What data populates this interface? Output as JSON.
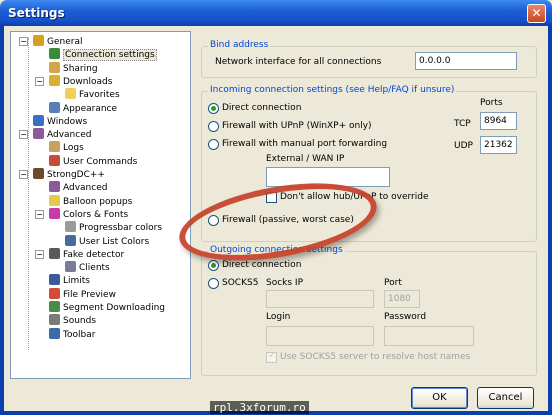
{
  "window": {
    "title": "Settings",
    "close_glyph": "✕"
  },
  "tree": {
    "items": [
      {
        "label": "General",
        "icon": "general-icon",
        "color": "#d8a020",
        "expander": "−"
      },
      {
        "label": "Connection settings",
        "icon": "connection-icon",
        "color": "#3a8a3a",
        "selected": true
      },
      {
        "label": "Sharing",
        "icon": "sharing-icon",
        "color": "#d4a64a"
      },
      {
        "label": "Downloads",
        "icon": "downloads-icon",
        "color": "#d8b030",
        "expander": "−"
      },
      {
        "label": "Favorites",
        "icon": "folder-icon",
        "color": "#f2cf5a"
      },
      {
        "label": "Appearance",
        "icon": "appearance-icon",
        "color": "#5a7fb8"
      },
      {
        "label": "Windows",
        "icon": "windows-icon",
        "color": "#3a6fc8"
      },
      {
        "label": "Advanced",
        "icon": "advanced-icon",
        "color": "#8a5a9a",
        "expander": "−"
      },
      {
        "label": "Logs",
        "icon": "logs-icon",
        "color": "#c8a060"
      },
      {
        "label": "User Commands",
        "icon": "user-commands-icon",
        "color": "#c84a3a"
      },
      {
        "label": "StrongDC++",
        "icon": "strongdc-icon",
        "color": "#6a4a2a",
        "expander": "−"
      },
      {
        "label": "Advanced",
        "icon": "advanced-icon",
        "color": "#8a5a9a"
      },
      {
        "label": "Balloon popups",
        "icon": "balloon-icon",
        "color": "#e8c84a"
      },
      {
        "label": "Colors & Fonts",
        "icon": "colors-icon",
        "color": "#c83aa8",
        "expander": "−"
      },
      {
        "label": "Progressbar colors",
        "icon": "progressbar-icon",
        "color": "#9a9a9a"
      },
      {
        "label": "User List Colors",
        "icon": "userlist-icon",
        "color": "#4a6a9a"
      },
      {
        "label": "Fake detector",
        "icon": "fake-detector-icon",
        "color": "#5a5a5a",
        "expander": "−"
      },
      {
        "label": "Clients",
        "icon": "clients-icon",
        "color": "#7a7a9a"
      },
      {
        "label": "Limits",
        "icon": "limits-icon",
        "color": "#3a5a9a"
      },
      {
        "label": "File Preview",
        "icon": "file-preview-icon",
        "color": "#d44a3a"
      },
      {
        "label": "Segment Downloading",
        "icon": "segment-icon",
        "color": "#4a8a4a"
      },
      {
        "label": "Sounds",
        "icon": "sounds-icon",
        "color": "#7a7a7a"
      },
      {
        "label": "Toolbar",
        "icon": "toolbar-icon",
        "color": "#3a6aa8"
      }
    ]
  },
  "bind": {
    "title": "Bind address",
    "label": "Network interface for all connections",
    "value": "0.0.0.0"
  },
  "incoming": {
    "title": "Incoming connection settings (see Help/FAQ if unsure)",
    "ports_label": "Ports",
    "direct": "Direct connection",
    "upnp": "Firewall with UPnP (WinXP+ only)",
    "manual": "Firewall with manual port forwarding",
    "passive": "Firewall (passive, worst case)",
    "tcp_label": "TCP",
    "tcp_value": "8964",
    "udp_label": "UDP",
    "udp_value": "21362",
    "wan_label": "External / WAN IP",
    "wan_value": "",
    "override_label": "Don't allow hub/UPnP to override"
  },
  "outgoing": {
    "title": "Outgoing connection settings",
    "direct": "Direct connection",
    "socks": "SOCKS5",
    "socks_ip_label": "Socks IP",
    "socks_ip_value": "",
    "port_label": "Port",
    "port_value": "1080",
    "login_label": "Login",
    "login_value": "",
    "password_label": "Password",
    "password_value": "",
    "resolve_label": "Use SOCKS5 server to resolve host names"
  },
  "buttons": {
    "ok": "OK",
    "cancel": "Cancel"
  },
  "watermark": "rpl.3xforum.ro"
}
